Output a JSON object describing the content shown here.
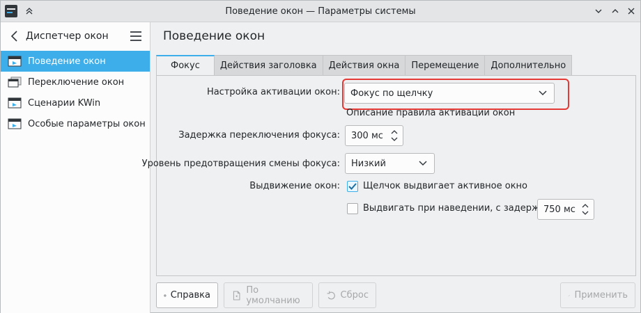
{
  "window": {
    "title": "Поведение окон — Параметры системы"
  },
  "sidebar": {
    "title": "Диспетчер окон",
    "items": [
      {
        "label": "Поведение окон",
        "active": true
      },
      {
        "label": "Переключение окон",
        "active": false
      },
      {
        "label": "Сценарии KWin",
        "active": false
      },
      {
        "label": "Особые параметры окон",
        "active": false
      }
    ]
  },
  "main": {
    "title": "Поведение окон",
    "tabs": [
      {
        "label": "Фокус",
        "active": true
      },
      {
        "label": "Действия заголовка",
        "active": false
      },
      {
        "label": "Действия окна",
        "active": false
      },
      {
        "label": "Перемещение",
        "active": false
      },
      {
        "label": "Дополнительно",
        "active": false
      }
    ],
    "focus": {
      "activation_label": "Настройка активации окон:",
      "activation_value": "Фокус по щелчку",
      "activation_description": "Описание правила активации окон",
      "delay_label": "Задержка переключения фокуса:",
      "delay_value": "300 мс",
      "prevention_label": "Уровень предотвращения смены фокуса:",
      "prevention_value": "Низкий",
      "raise_label": "Выдвижение окон:",
      "click_raise_label": "Щелчок выдвигает активное окно",
      "click_raise_checked": true,
      "hover_raise_label": "Выдвигать при наведении, с задержкой:",
      "hover_raise_checked": false,
      "hover_delay_value": "750 мс"
    }
  },
  "buttons": {
    "help": "Справка",
    "defaults": "По умолчанию",
    "reset": "Сброс",
    "apply": "Применить"
  },
  "colors": {
    "accent": "#3daee9",
    "highlight": "#e53935"
  }
}
